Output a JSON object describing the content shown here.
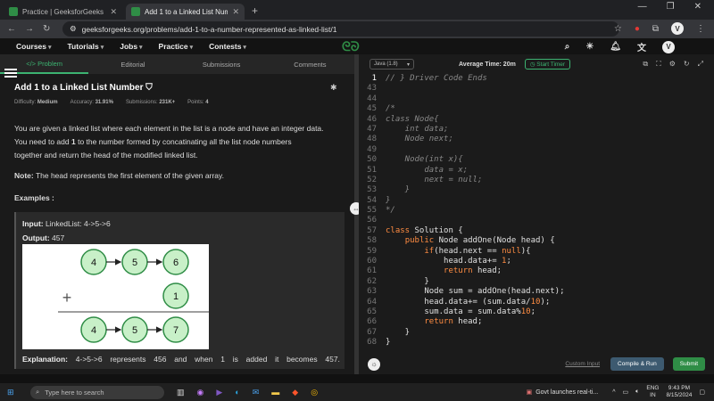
{
  "browser": {
    "tabs": [
      {
        "title": "Practice | GeeksforGeeks | A co",
        "active": false
      },
      {
        "title": "Add 1 to a Linked List Number",
        "active": true
      }
    ],
    "url": "geeksforgeeks.org/problems/add-1-to-a-number-represented-as-linked-list/1",
    "profile_initial": "V"
  },
  "site_nav": {
    "items": [
      "Courses",
      "Tutorials",
      "Jobs",
      "Practice",
      "Contests"
    ],
    "avatar": "V"
  },
  "problem": {
    "tabs": [
      "</> Problem",
      "Editorial",
      "Submissions",
      "Comments"
    ],
    "title": "Add 1 to a Linked List Number",
    "difficulty_label": "Difficulty:",
    "difficulty": "Medium",
    "accuracy_label": "Accuracy:",
    "accuracy": "31.91%",
    "submissions_label": "Submissions:",
    "submissions": "231K+",
    "points_label": "Points:",
    "points": "4",
    "desc_1": "You are given a linked list where each element in the list is a node and have an integer data.",
    "desc_2a": "You need to add ",
    "desc_2b": "1",
    "desc_2c": " to the number formed by concatinating all the list node numbers",
    "desc_3": "together and return the head of the modified linked list.",
    "note_label": "Note:",
    "note": " The head represents the first element of the given array.",
    "examples_label": "Examples :",
    "input_label": "Input:",
    "input": " LinkedList: 4->5->6",
    "output_label": "Output:",
    "output": " 457",
    "explanation_label": "Explanation:",
    "explanation": [
      "4->5->6",
      "represents",
      "456",
      "and",
      "when",
      "1",
      "is",
      "added",
      "it",
      "becomes",
      "457."
    ],
    "diagram": {
      "top": [
        "4",
        "5",
        "6"
      ],
      "plus": "+",
      "addend": "1",
      "bottom": [
        "4",
        "5",
        "7"
      ]
    }
  },
  "editor": {
    "language": "Java (1.8)",
    "avg_time": "Average Time: 20m",
    "timer": "Start Timer",
    "custom_input": "Custom Input",
    "compile": "Compile & Run",
    "submit": "Submit",
    "lines": [
      {
        "n": "1",
        "t": "// } Driver Code Ends"
      },
      {
        "n": "43",
        "t": ""
      },
      {
        "n": "44",
        "t": ""
      },
      {
        "n": "45",
        "t": "/*"
      },
      {
        "n": "46",
        "t": "class Node{"
      },
      {
        "n": "47",
        "t": "    int data;"
      },
      {
        "n": "48",
        "t": "    Node next;"
      },
      {
        "n": "49",
        "t": ""
      },
      {
        "n": "50",
        "t": "    Node(int x){"
      },
      {
        "n": "51",
        "t": "        data = x;"
      },
      {
        "n": "52",
        "t": "        next = null;"
      },
      {
        "n": "53",
        "t": "    }"
      },
      {
        "n": "54",
        "t": "}"
      },
      {
        "n": "55",
        "t": "*/"
      },
      {
        "n": "56",
        "t": ""
      },
      {
        "n": "57",
        "t": "class Solution {"
      },
      {
        "n": "58",
        "t": "    public Node addOne(Node head) {"
      },
      {
        "n": "59",
        "t": "        if(head.next == null){"
      },
      {
        "n": "60",
        "t": "            head.data+= 1;"
      },
      {
        "n": "61",
        "t": "            return head;"
      },
      {
        "n": "62",
        "t": "        }"
      },
      {
        "n": "63",
        "t": "        Node sum = addOne(head.next);"
      },
      {
        "n": "64",
        "t": "        head.data+= (sum.data/10);"
      },
      {
        "n": "65",
        "t": "        sum.data = sum.data%10;"
      },
      {
        "n": "66",
        "t": "        return head;"
      },
      {
        "n": "67",
        "t": "    }"
      },
      {
        "n": "68",
        "t": "}"
      }
    ]
  },
  "taskbar": {
    "search_placeholder": "Type here to search",
    "news": "Govt launches real-ti...",
    "lang_1": "ENG",
    "lang_2": "IN",
    "time": "9:43 PM",
    "date": "8/15/2024"
  }
}
